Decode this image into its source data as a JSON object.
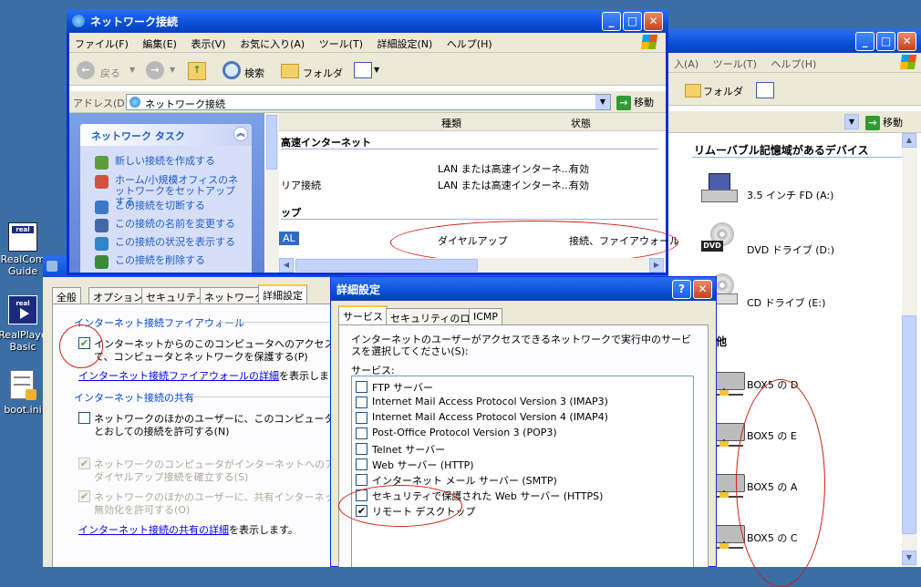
{
  "desktop": {
    "icons": [
      {
        "label_line1": "RealCom",
        "label_line2": "Guide",
        "icon": "real-icon"
      },
      {
        "label_line1": "RealPlaye",
        "label_line2": "Basic",
        "icon": "realplayer-icon"
      },
      {
        "label_line1": "boot.ini",
        "label_line2": "",
        "icon": "file-icon"
      }
    ]
  },
  "mycomputer": {
    "menu_tail": [
      "入(A)",
      "ツール(T)",
      "ヘルプ(H)"
    ],
    "folder_btn": "フォルダ",
    "go_label": "移動",
    "section_removable": "リムーバブル記憶域があるデバイス",
    "drives": [
      {
        "label": "3.5 インチ FD (A:)",
        "icon": "floppy-icon"
      },
      {
        "label": "DVD ドライブ (D:)",
        "icon": "dvd-drive-icon"
      },
      {
        "label": "CD ドライブ (E:)",
        "icon": "cd-drive-icon"
      }
    ],
    "section_other": "他",
    "network_drives": [
      {
        "label": "BOX5 の D"
      },
      {
        "label": "BOX5 の E"
      },
      {
        "label": "BOX5 の A"
      },
      {
        "label": "BOX5 の C"
      }
    ]
  },
  "netwindow": {
    "title": "ネットワーク接続",
    "menu": [
      "ファイル(F)",
      "編集(E)",
      "表示(V)",
      "お気に入り(A)",
      "ツール(T)",
      "詳細設定(N)",
      "ヘルプ(H)"
    ],
    "toolbar": {
      "back": "戻る",
      "search": "検索",
      "folder": "フォルダ"
    },
    "address_label": "アドレス(D)",
    "address_value": "ネットワーク接続",
    "go_label": "移動",
    "tasks_header": "ネットワーク タスク",
    "tasks": [
      "新しい接続を作成する",
      "ホーム/小規模オフィスのネットワークをセットアップする",
      "この接続を切断する",
      "この接続の名前を変更する",
      "この接続の状況を表示する",
      "この接続を削除する"
    ],
    "columns": {
      "type": "種類",
      "status": "状態"
    },
    "group_lan": "高速インターネット",
    "rows": [
      {
        "name": "",
        "type": "LAN または高速インターネ...",
        "status": "有効"
      },
      {
        "name": "リア接続",
        "type": "LAN または高速インターネ...",
        "status": "有効"
      }
    ],
    "group_dialup": "ップ",
    "dialup_row": {
      "name": "AL",
      "type": "ダイヤルアップ",
      "status": "接続、ファイアウォール"
    }
  },
  "propdialog": {
    "tabs": [
      "全般",
      "オプション",
      "セキュリティ",
      "ネットワーク",
      "詳細設定"
    ],
    "firewall_group": "インターネット接続ファイアウォール",
    "firewall_check": "インターネットからのこのコンピュータへのアクセスを制限し",
    "firewall_check2": "て、コンピュータとネットワークを保護する(P)",
    "firewall_link": "インターネット接続ファイアウォールの詳細",
    "firewall_link_suffix": "を表示します。",
    "sharing_group": "インターネット接続の共有",
    "share_check": "ネットワークのほかのユーザーに、このコンピュータのインター",
    "share_check2": "とおしての接続を許可する(N)",
    "dial_check": "ネットワークのコンピュータがインターネットへのアクセスを試",
    "dial_check2": "ダイヤルアップ接続を確立する(S)",
    "control_check": "ネットワークのほかのユーザーに、共有インターネット接続",
    "control_check2": "無効化を許可する(O)",
    "sharing_link": "インターネット接続の共有の詳細",
    "sharing_link_suffix": "を表示します。"
  },
  "advdialog": {
    "title": "詳細設定",
    "help_btn": "?",
    "tabs": [
      "サービス",
      "セキュリティのログ",
      "ICMP"
    ],
    "description": "インターネットのユーザーがアクセスできるネットワークで実行中のサービスを選択してください(S):",
    "services_label": "サービス:",
    "services": [
      {
        "label": "FTP サーバー",
        "checked": false
      },
      {
        "label": "Internet Mail Access Protocol Version 3 (IMAP3)",
        "checked": false
      },
      {
        "label": "Internet Mail Access Protocol Version 4 (IMAP4)",
        "checked": false
      },
      {
        "label": "Post-Office Protocol Version 3 (POP3)",
        "checked": false
      },
      {
        "label": "Telnet サーバー",
        "checked": false
      },
      {
        "label": "Web サーバー (HTTP)",
        "checked": false
      },
      {
        "label": "インターネット メール サーバー (SMTP)",
        "checked": false
      },
      {
        "label": "セキュリティで保護された Web サーバー (HTTPS)",
        "checked": false
      },
      {
        "label": "リモート デスクトップ",
        "checked": true
      }
    ]
  },
  "colors": {
    "annotation": "#d21c0e",
    "xp_blue": "#0a4fd8"
  }
}
